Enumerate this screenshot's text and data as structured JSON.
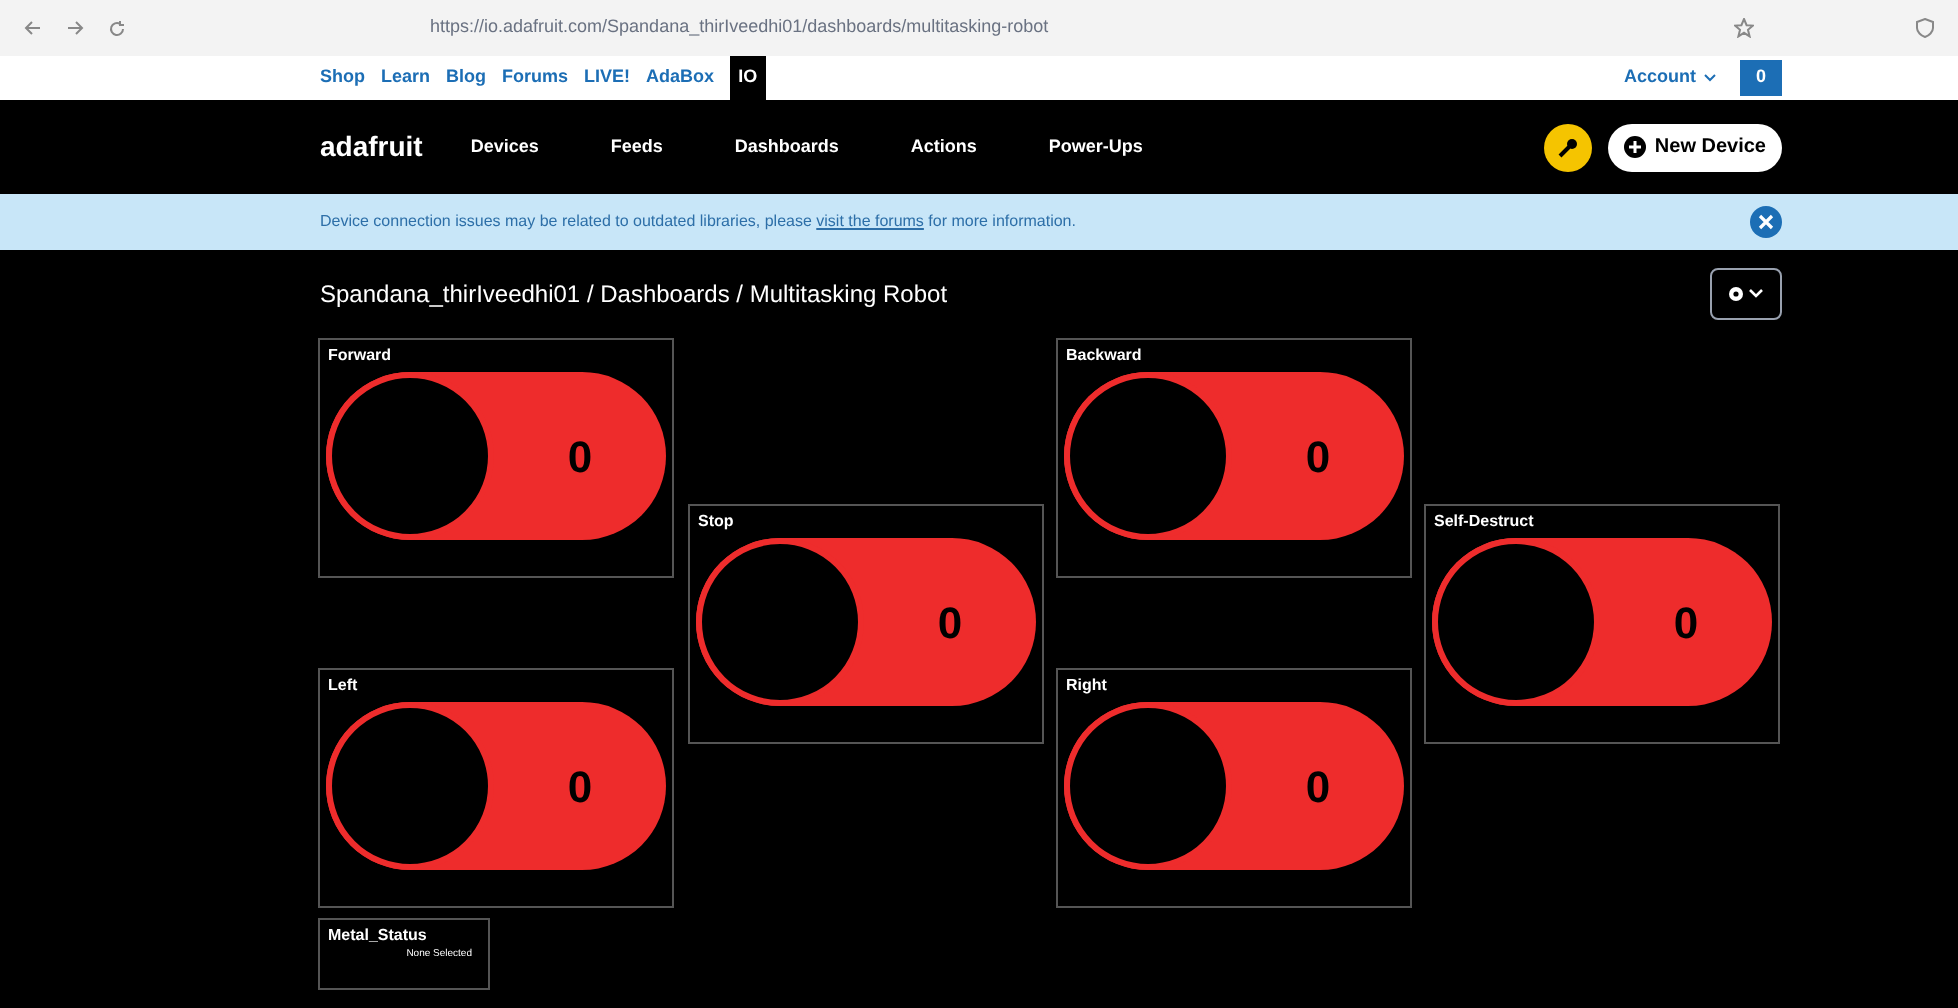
{
  "browser": {
    "url": "https://io.adafruit.com/Spandana_thirIveedhi01/dashboards/multitasking-robot"
  },
  "top_links": [
    {
      "label": "Shop",
      "selected": false
    },
    {
      "label": "Learn",
      "selected": false
    },
    {
      "label": "Blog",
      "selected": false
    },
    {
      "label": "Forums",
      "selected": false
    },
    {
      "label": "LIVE!",
      "selected": false
    },
    {
      "label": "AdaBox",
      "selected": false
    },
    {
      "label": "IO",
      "selected": true
    }
  ],
  "account": {
    "label": "Account",
    "cart_count": "0"
  },
  "nav": {
    "logo": "adafruit",
    "items": [
      "Devices",
      "Feeds",
      "Dashboards",
      "Actions",
      "Power-Ups"
    ],
    "new_device": "New Device"
  },
  "banner": {
    "before": "Device connection issues may be related to outdated libraries, please ",
    "link": "visit the forums",
    "after": " for more information."
  },
  "breadcrumb": "Spandana_thirIveedhi01 / Dashboards / Multitasking Robot",
  "blocks": [
    {
      "kind": "toggle",
      "title": "Forward",
      "value": "0",
      "on": false
    },
    {
      "kind": "toggle",
      "title": "Stop",
      "value": "0",
      "on": false
    },
    {
      "kind": "toggle",
      "title": "Backward",
      "value": "0",
      "on": false
    },
    {
      "kind": "toggle",
      "title": "Self-Destruct",
      "value": "0",
      "on": false
    },
    {
      "kind": "toggle",
      "title": "Left",
      "value": "0",
      "on": false
    },
    {
      "kind": "toggle",
      "title": "Right",
      "value": "0",
      "on": false
    },
    {
      "kind": "text",
      "title": "Metal_Status",
      "value": "None Selected"
    }
  ]
}
